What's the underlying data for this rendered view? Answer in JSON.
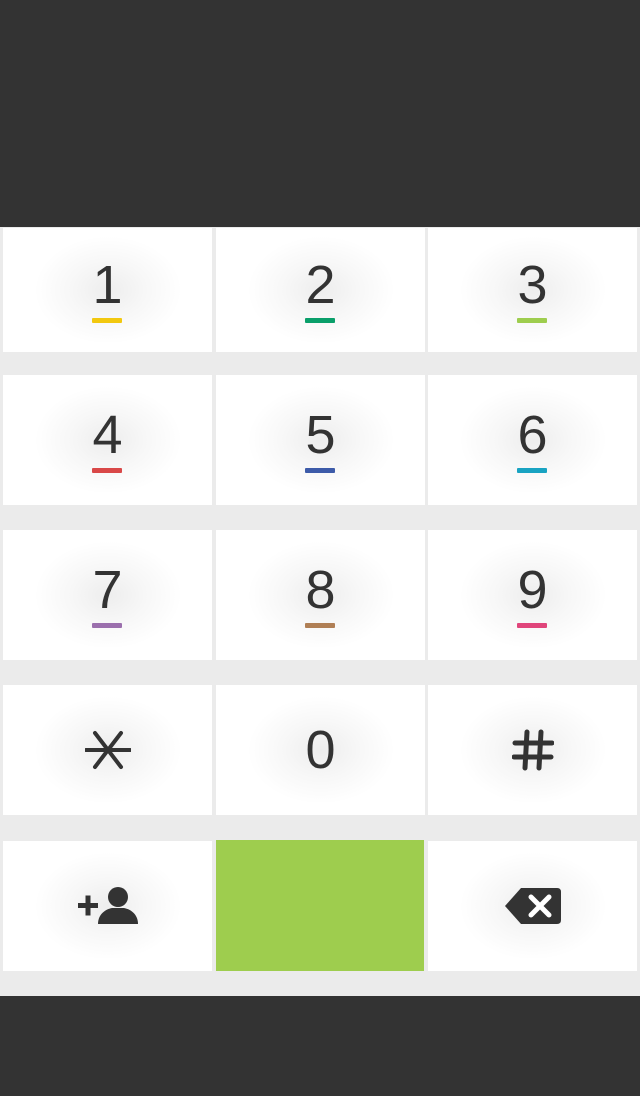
{
  "keypad": {
    "keys": [
      {
        "label": "1",
        "color": "#f2c80f"
      },
      {
        "label": "2",
        "color": "#0a9f6a"
      },
      {
        "label": "3",
        "color": "#9ecd4e"
      },
      {
        "label": "4",
        "color": "#d94848"
      },
      {
        "label": "5",
        "color": "#3d5ba9"
      },
      {
        "label": "6",
        "color": "#19a3c2"
      },
      {
        "label": "7",
        "color": "#9b6fad"
      },
      {
        "label": "8",
        "color": "#b07f55"
      },
      {
        "label": "9",
        "color": "#e0457b"
      },
      {
        "label": "0"
      }
    ],
    "star": "asterisk-icon",
    "hash": "hash-icon"
  },
  "actions": {
    "add_contact": "add-contact-icon",
    "call_color": "#9ecd4e",
    "backspace": "backspace-icon"
  },
  "theme": {
    "bar_color": "#333333",
    "background": "#ebebeb",
    "key_background": "#ffffff",
    "text_color": "#333333"
  }
}
